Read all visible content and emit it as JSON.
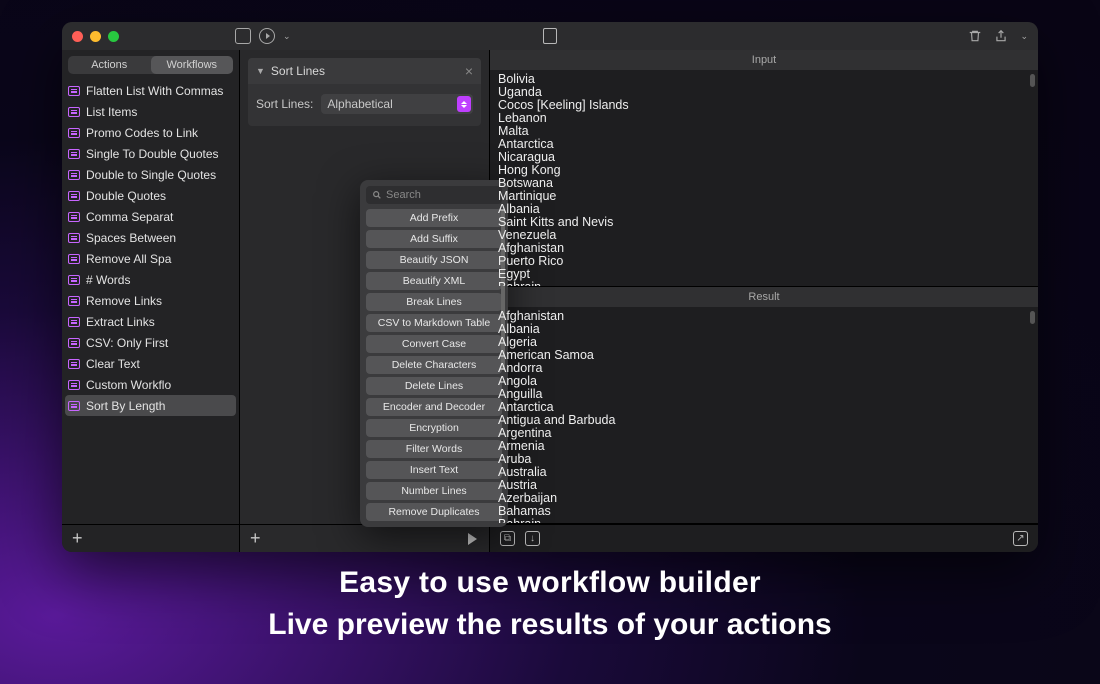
{
  "titlebar": {},
  "sidebar": {
    "tab_actions": "Actions",
    "tab_workflows": "Workflows",
    "items": [
      {
        "label": "Flatten List With Commas"
      },
      {
        "label": "List Items"
      },
      {
        "label": "Promo Codes to Link"
      },
      {
        "label": "Single To Double Quotes"
      },
      {
        "label": "Double to Single Quotes"
      },
      {
        "label": "Double Quotes"
      },
      {
        "label": "Comma Separat"
      },
      {
        "label": "Spaces Between"
      },
      {
        "label": "Remove All Spa"
      },
      {
        "label": "# Words"
      },
      {
        "label": "Remove Links"
      },
      {
        "label": "Extract Links"
      },
      {
        "label": "CSV: Only First"
      },
      {
        "label": "Clear Text"
      },
      {
        "label": "Custom Workflo"
      },
      {
        "label": "Sort By Length"
      }
    ],
    "selected_index": 15
  },
  "action": {
    "title": "Sort Lines",
    "param_label": "Sort Lines:",
    "param_value": "Alphabetical"
  },
  "popup": {
    "search_placeholder": "Search",
    "items": [
      "Add Prefix",
      "Add Suffix",
      "Beautify JSON",
      "Beautify XML",
      "Break Lines",
      "CSV to Markdown Table",
      "Convert Case",
      "Delete Characters",
      "Delete Lines",
      "Encoder and Decoder",
      "Encryption",
      "Filter Words",
      "Insert Text",
      "Number Lines",
      "Remove Duplicates"
    ]
  },
  "panes": {
    "input_label": "Input",
    "result_label": "Result",
    "input_lines": [
      "Bolivia",
      "Uganda",
      "Cocos [Keeling] Islands",
      "Lebanon",
      "Malta",
      "Antarctica",
      "Nicaragua",
      "Hong Kong",
      "Botswana",
      "Martinique",
      "Albania",
      "Saint Kitts and Nevis",
      "Venezuela",
      "Afghanistan",
      "Puerto Rico",
      "Egypt",
      "Bahrain"
    ],
    "result_lines": [
      "Afghanistan",
      "Albania",
      "Algeria",
      "American Samoa",
      "Andorra",
      "Angola",
      "Anguilla",
      "Antarctica",
      "Antigua and Barbuda",
      "Argentina",
      "Armenia",
      "Aruba",
      "Australia",
      "Austria",
      "Azerbaijan",
      "Bahamas",
      "Bahrain"
    ]
  },
  "captions": {
    "l1": "Easy to use workflow builder",
    "l2": "Live preview the results of your actions"
  }
}
